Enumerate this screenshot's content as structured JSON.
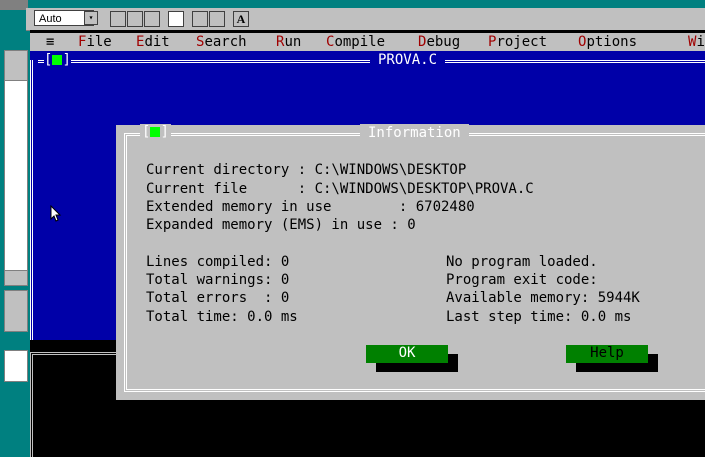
{
  "toolbar": {
    "font_size": "Auto",
    "dropdown_arrow": "▾",
    "font_button": "A"
  },
  "menubar": {
    "system": "≡",
    "items": [
      {
        "hot": "F",
        "rest": "ile"
      },
      {
        "hot": "E",
        "rest": "dit"
      },
      {
        "hot": "S",
        "rest": "earch"
      },
      {
        "hot": "R",
        "rest": "un"
      },
      {
        "hot": "C",
        "rest": "ompile"
      },
      {
        "hot": "D",
        "rest": "ebug"
      },
      {
        "hot": "P",
        "rest": "roject"
      },
      {
        "hot": "O",
        "rest": "ptions"
      },
      {
        "hot": "W",
        "rest": "i"
      }
    ]
  },
  "editor": {
    "title": "PROVA.C",
    "close_left": "[",
    "close_right": "]"
  },
  "dialog": {
    "title": "Information",
    "close_left": "[",
    "close_right": "]",
    "lines": [
      "Current directory : C:\\WINDOWS\\DESKTOP",
      "Current file      : C:\\WINDOWS\\DESKTOP\\PROVA.C",
      "Extended memory in use        : 6702480",
      "Expanded memory (EMS) in use : 0"
    ],
    "left_stats": [
      "Lines compiled: 0",
      "Total warnings: 0",
      "Total errors  : 0",
      "Total time: 0.0 ms"
    ],
    "right_stats": [
      "No program loaded.",
      "Program exit code:",
      "Available memory: 5944K",
      "Last step time: 0.0 ms"
    ],
    "ok_label": "OK",
    "help_label": "Help"
  },
  "colors": {
    "editor_bg": "#0000a8",
    "dialog_bg": "#c0c0c0",
    "button_bg": "#008000",
    "desktop": "#008080"
  }
}
